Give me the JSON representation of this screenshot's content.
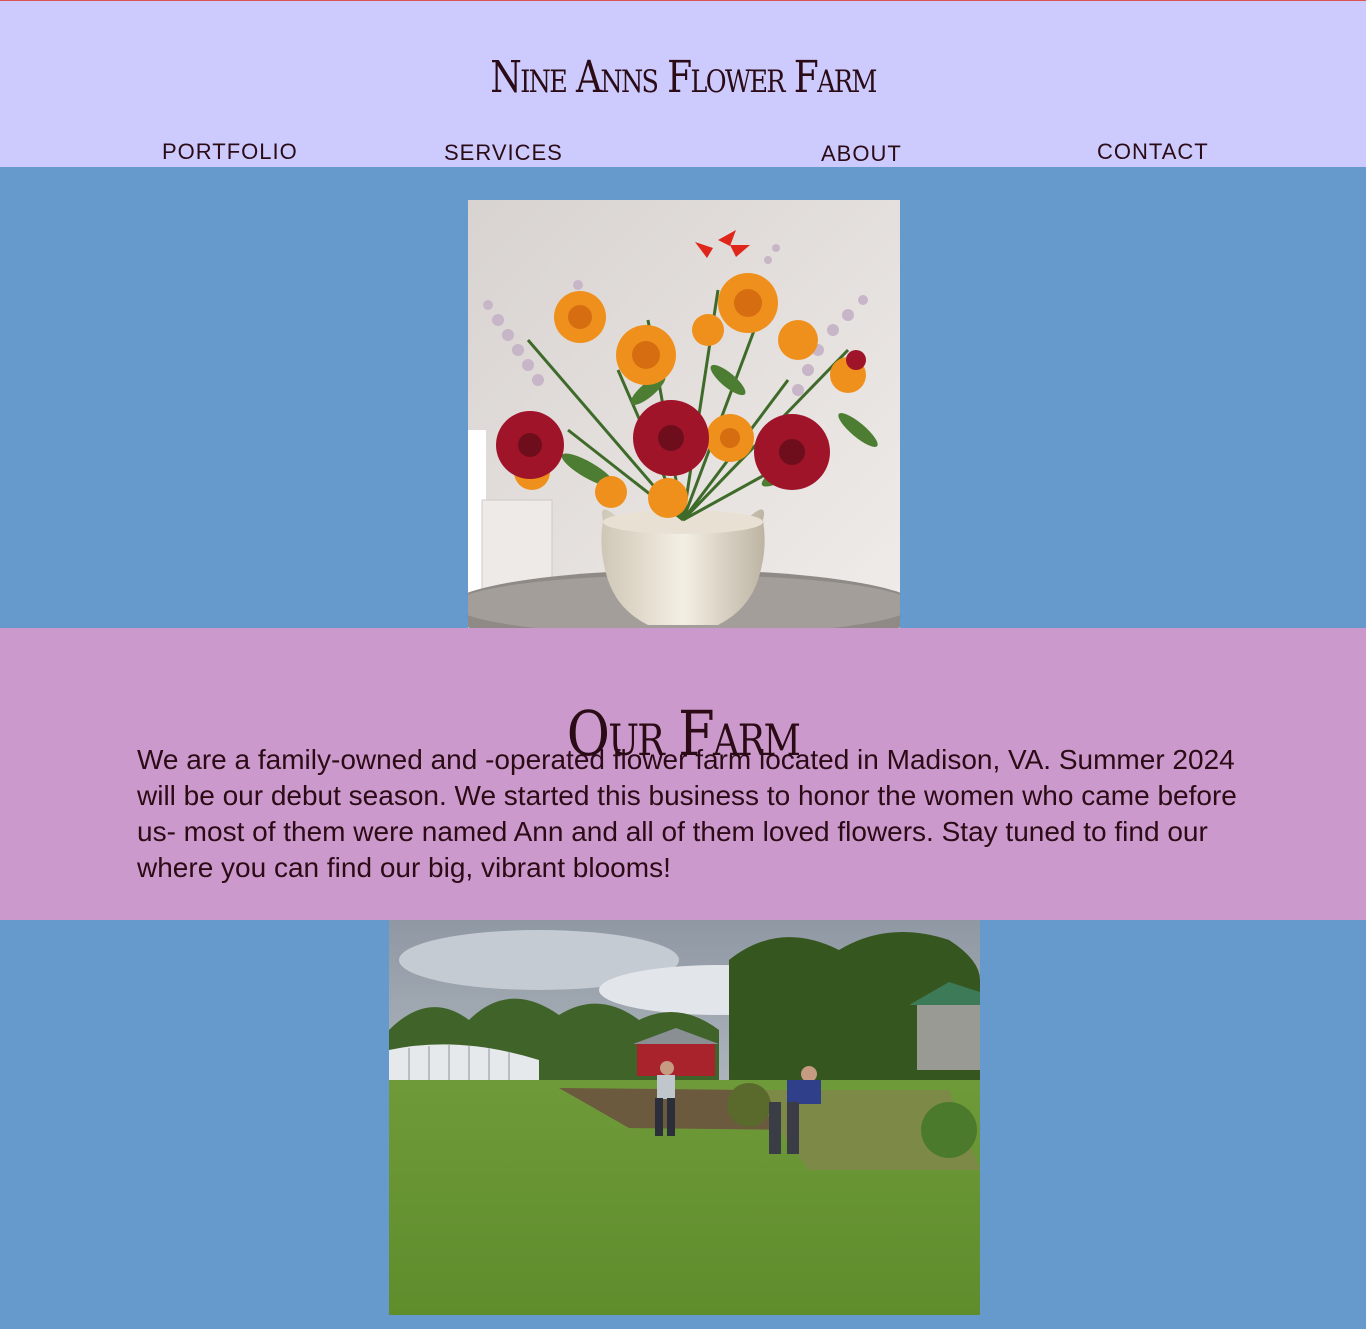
{
  "header": {
    "site_title": "Nine Anns Flower Farm",
    "nav": [
      {
        "label": "PORTFOLIO"
      },
      {
        "label": "SERVICES"
      },
      {
        "label": "ABOUT"
      },
      {
        "label": "CONTACT"
      }
    ]
  },
  "hero_image": {
    "description": "flower-bouquet-photo"
  },
  "farm_section": {
    "heading": "Our Farm",
    "body": "We are a family-owned and -operated flower farm located in Madison, VA. Summer 2024 will be our debut season. We started this business to honor the women who came before us- most of them were named Ann and all of them loved flowers. Stay tuned to find our where you can find our big, vibrant blooms!"
  },
  "farm_image": {
    "description": "farm-field-photo"
  },
  "colors": {
    "header_bg": "#cdcafe",
    "page_bg": "#6699cc",
    "farm_band_bg": "#cc99cc",
    "text": "#2a0b16"
  }
}
